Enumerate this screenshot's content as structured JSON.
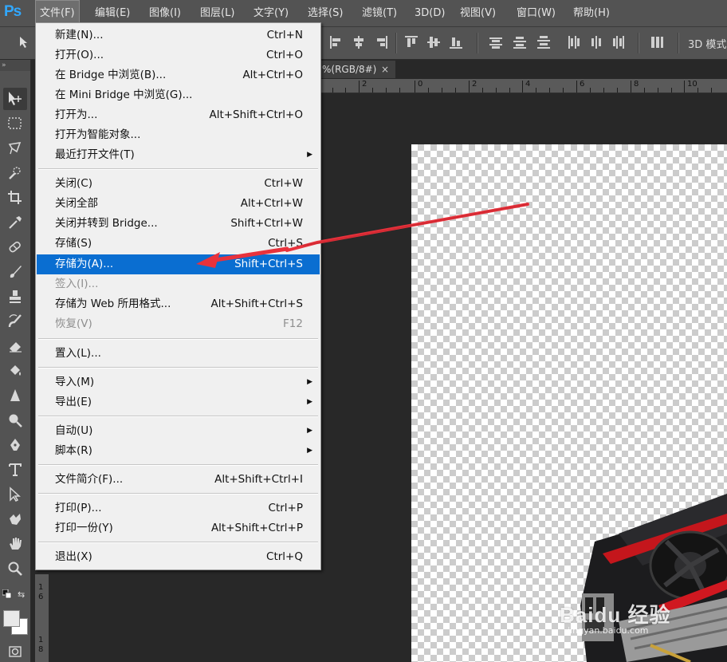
{
  "menubar": {
    "logo": "Ps",
    "items": [
      {
        "label": "文件(F)",
        "active": true
      },
      {
        "label": "编辑(E)"
      },
      {
        "label": "图像(I)"
      },
      {
        "label": "图层(L)"
      },
      {
        "label": "文字(Y)"
      },
      {
        "label": "选择(S)"
      },
      {
        "label": "滤镜(T)"
      },
      {
        "label": "3D(D)"
      },
      {
        "label": "视图(V)"
      },
      {
        "label": "窗口(W)"
      },
      {
        "label": "帮助(H)"
      }
    ]
  },
  "options_bar": {
    "mode_3d_label": "3D 模式"
  },
  "toolbar": {
    "grip": "»"
  },
  "document_tab": {
    "title": "%(RGB/8#)",
    "close": "×"
  },
  "rulers": {
    "horizontal": [
      "2",
      "0",
      "2",
      "4",
      "6",
      "8",
      "10"
    ],
    "vertical": [
      "1",
      "6",
      "1",
      "8"
    ]
  },
  "canvas": {
    "watermark": "Baidu 经验",
    "watermark_sub": "jingyan.baidu.com"
  },
  "file_menu": {
    "items": [
      {
        "label": "新建(N)...",
        "shortcut": "Ctrl+N"
      },
      {
        "label": "打开(O)...",
        "shortcut": "Ctrl+O"
      },
      {
        "label": "在 Bridge 中浏览(B)...",
        "shortcut": "Alt+Ctrl+O"
      },
      {
        "label": "在 Mini Bridge 中浏览(G)...",
        "shortcut": ""
      },
      {
        "label": "打开为...",
        "shortcut": "Alt+Shift+Ctrl+O"
      },
      {
        "label": "打开为智能对象...",
        "shortcut": ""
      },
      {
        "label": "最近打开文件(T)",
        "shortcut": "",
        "submenu": true
      },
      {
        "label": "关闭(C)",
        "shortcut": "Ctrl+W"
      },
      {
        "label": "关闭全部",
        "shortcut": "Alt+Ctrl+W"
      },
      {
        "label": "关闭并转到 Bridge...",
        "shortcut": "Shift+Ctrl+W"
      },
      {
        "label": "存储(S)",
        "shortcut": "Ctrl+S"
      },
      {
        "label": "存储为(A)...",
        "shortcut": "Shift+Ctrl+S",
        "highlighted": true
      },
      {
        "label": "签入(I)...",
        "shortcut": "",
        "disabled": true
      },
      {
        "label": "存储为 Web 所用格式...",
        "shortcut": "Alt+Shift+Ctrl+S"
      },
      {
        "label": "恢复(V)",
        "shortcut": "F12",
        "disabled": true
      },
      {
        "label": "置入(L)...",
        "shortcut": ""
      },
      {
        "label": "导入(M)",
        "shortcut": "",
        "submenu": true
      },
      {
        "label": "导出(E)",
        "shortcut": "",
        "submenu": true
      },
      {
        "label": "自动(U)",
        "shortcut": "",
        "submenu": true
      },
      {
        "label": "脚本(R)",
        "shortcut": "",
        "submenu": true
      },
      {
        "label": "文件简介(F)...",
        "shortcut": "Alt+Shift+Ctrl+I"
      },
      {
        "label": "打印(P)...",
        "shortcut": "Ctrl+P"
      },
      {
        "label": "打印一份(Y)",
        "shortcut": "Alt+Shift+Ctrl+P"
      },
      {
        "label": "退出(X)",
        "shortcut": "Ctrl+Q"
      }
    ]
  },
  "colors": {
    "highlight": "#0a6ed1",
    "annotation_arrow": "#e8323c",
    "ps_logo": "#31a8ff"
  }
}
